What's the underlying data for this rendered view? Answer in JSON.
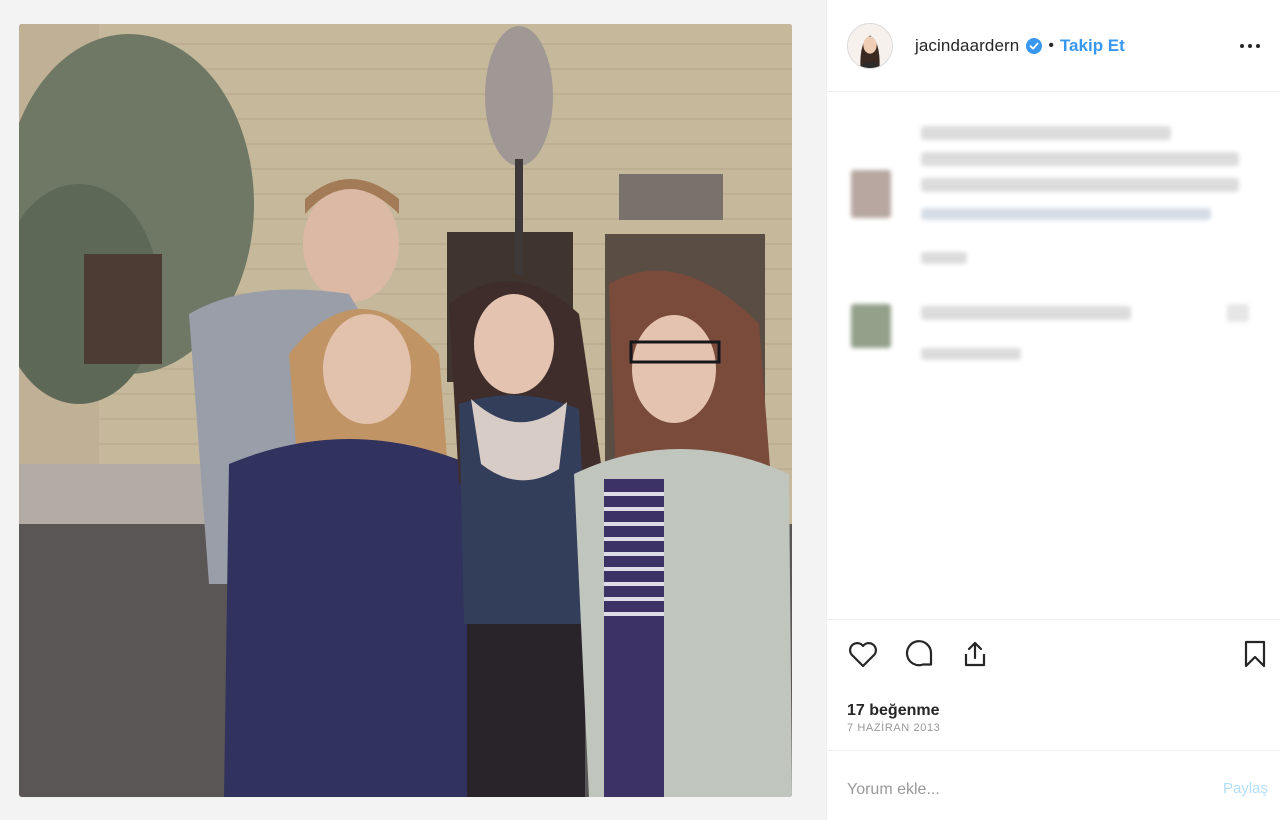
{
  "post": {
    "username": "jacindaardern",
    "verified": true,
    "separator": "•",
    "follow_label": "Takip Et",
    "likes_text": "17 beğenme",
    "date_text": "7 HAZİRAN 2013"
  },
  "comment_box": {
    "placeholder": "Yorum ekle...",
    "submit_label": "Paylaş"
  },
  "icons": {
    "more": "more-options-icon",
    "like": "heart-icon",
    "comment": "comment-bubble-icon",
    "share": "share-upload-icon",
    "save": "bookmark-icon",
    "verified": "verified-badge-icon"
  },
  "colors": {
    "accent": "#3897f0",
    "text": "#262626",
    "muted": "#999999",
    "border": "#efefef"
  }
}
